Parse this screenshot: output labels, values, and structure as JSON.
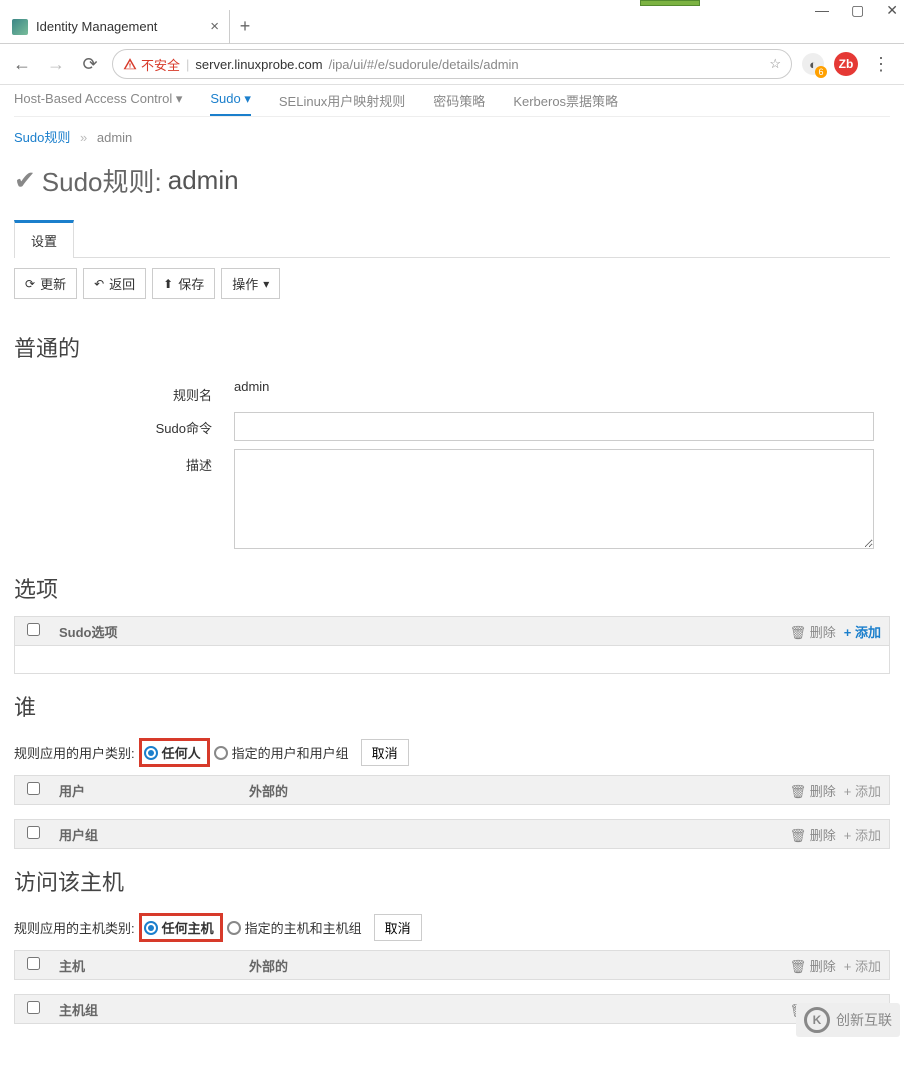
{
  "browser": {
    "tab_title": "Identity Management",
    "security_label": "不安全",
    "url_host": "server.linuxprobe.com",
    "url_path": "/ipa/ui/#/e/sudorule/details/admin",
    "ext_badge": "6",
    "avatar_initials": "Zb"
  },
  "topnav": {
    "items": [
      "Host-Based Access Control ▾",
      "Sudo ▾",
      "SELinux用户映射规则",
      "密码策略",
      "Kerberos票据策略"
    ],
    "active_index": 1
  },
  "breadcrumb": {
    "link": "Sudo规则",
    "current": "admin"
  },
  "title": {
    "prefix": "Sudo规则:",
    "name": "admin"
  },
  "tabs": {
    "settings": "设置"
  },
  "toolbar": {
    "refresh": "更新",
    "back": "返回",
    "save": "保存",
    "actions": "操作"
  },
  "general": {
    "heading": "普通的",
    "rule_name_label": "规则名",
    "rule_name_value": "admin",
    "sudo_order_label": "Sudo命令",
    "sudo_order_value": "",
    "description_label": "描述",
    "description_value": ""
  },
  "options": {
    "heading": "选项",
    "col_label": "Sudo选项",
    "delete": "删除",
    "add": "添加"
  },
  "who": {
    "heading": "谁",
    "category_label": "规则应用的用户类别:",
    "anyone": "任何人",
    "specified": "指定的用户和用户组",
    "cancel": "取消",
    "users_col": "用户",
    "external_col": "外部的",
    "usergroups_col": "用户组",
    "delete": "删除",
    "add": "添加"
  },
  "access": {
    "heading": "访问该主机",
    "category_label": "规则应用的主机类别:",
    "anyhost": "任何主机",
    "specified": "指定的主机和主机组",
    "cancel": "取消",
    "hosts_col": "主机",
    "external_col": "外部的",
    "hostgroups_col": "主机组",
    "delete": "删除",
    "add": "添加"
  },
  "watermark": "创新互联"
}
